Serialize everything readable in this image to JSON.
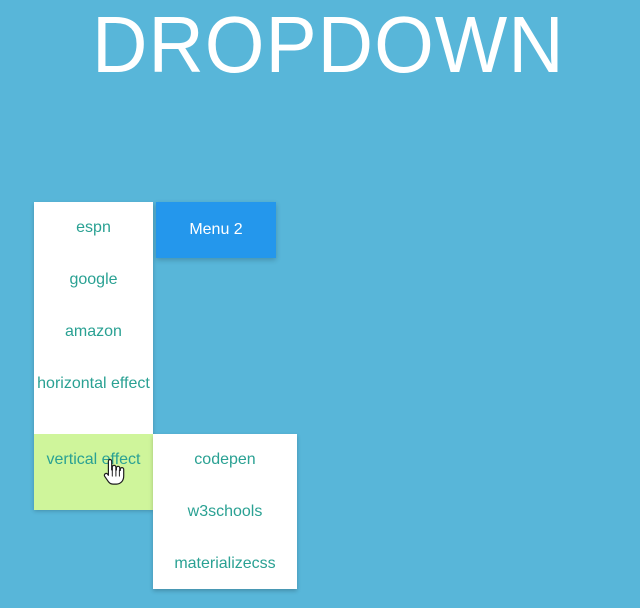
{
  "page": {
    "title": "DROPDOWN"
  },
  "buttons": {
    "menu2_label": "Menu 2"
  },
  "menu_primary": {
    "items": [
      "espn",
      "google",
      "amazon",
      "horizontal effect",
      "vertical effect"
    ],
    "active_item": "vertical effect"
  },
  "menu_secondary": {
    "items": [
      "codepen",
      "w3schools",
      "materializecss"
    ]
  },
  "colors": {
    "background": "#58b6d9",
    "menu_text": "#2aa193",
    "menu_bg": "#ffffff",
    "active_item_bg": "#cff59b",
    "button_bg": "#2497ec",
    "button_text": "#ffffff"
  },
  "icons": {
    "cursor": "hand-pointer-icon"
  }
}
